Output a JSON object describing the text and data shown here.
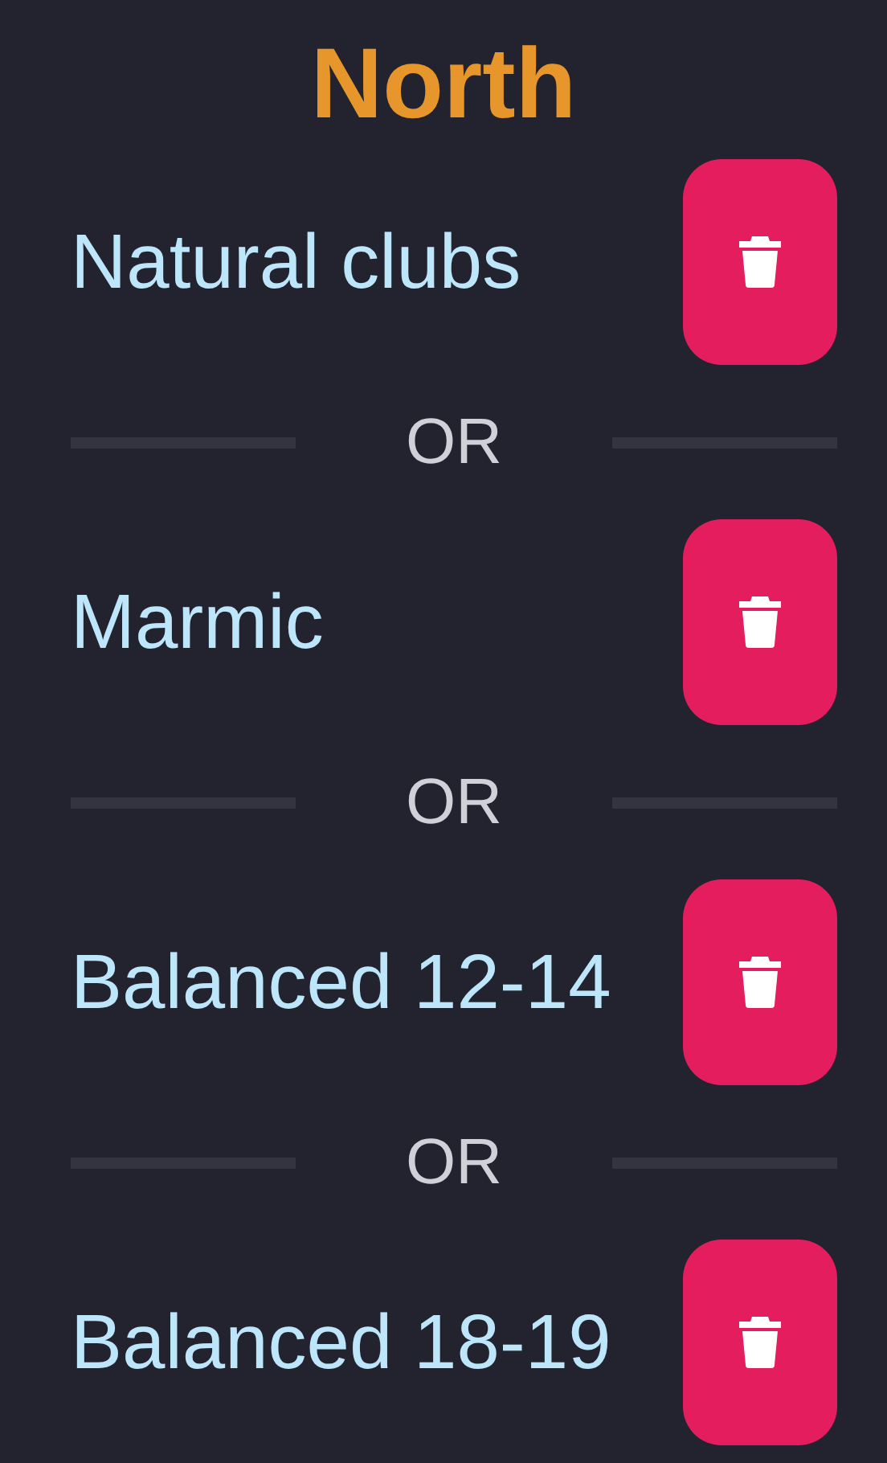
{
  "title": "North",
  "items": [
    {
      "label": "Natural clubs",
      "separator": "OR"
    },
    {
      "label": "Marmic",
      "separator": "OR"
    },
    {
      "label": "Balanced 12-14",
      "separator": "OR"
    },
    {
      "label": "Balanced 18-19"
    }
  ]
}
